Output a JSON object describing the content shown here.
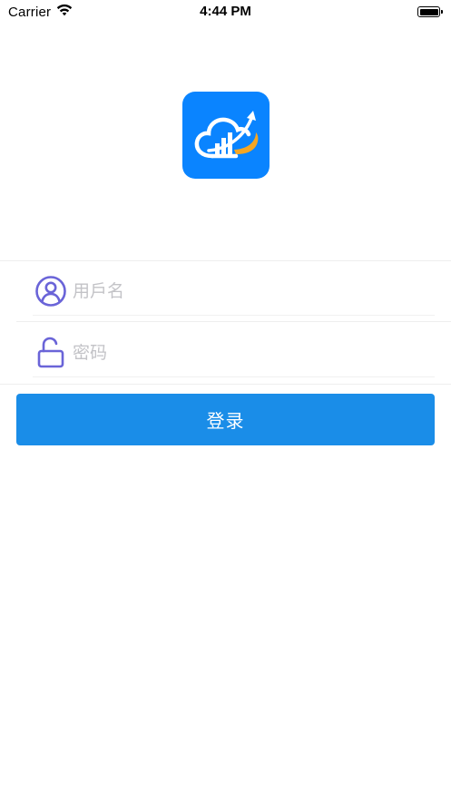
{
  "status_bar": {
    "carrier": "Carrier",
    "time": "4:44 PM",
    "battery_level": 1.0
  },
  "logo": {
    "icon": "cloud-chart-logo-icon",
    "background_color": "#0a84ff",
    "accent_color": "#f5a623"
  },
  "form": {
    "username": {
      "placeholder": "用戶名",
      "value": "",
      "icon": "user-circle-icon"
    },
    "password": {
      "placeholder": "密码",
      "value": "",
      "icon": "unlock-icon"
    },
    "icon_color": "#6a64d8"
  },
  "login_button": {
    "label": "登录",
    "color": "#1a8de8"
  }
}
